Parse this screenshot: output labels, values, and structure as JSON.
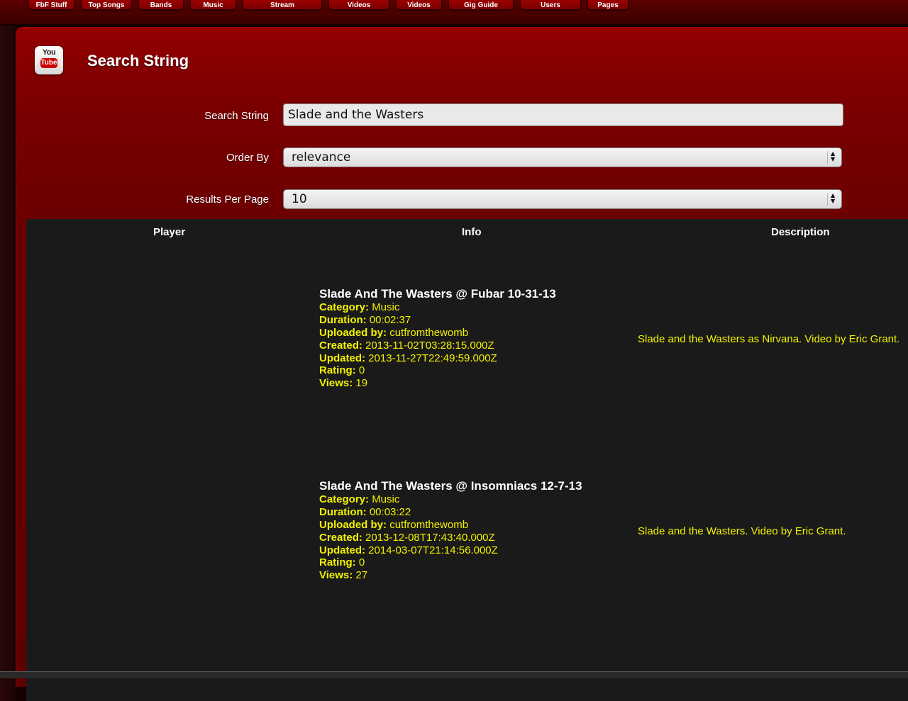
{
  "nav": {
    "items": [
      {
        "label": "FbF Stuff"
      },
      {
        "label": "Top Songs"
      },
      {
        "label": "Bands"
      },
      {
        "label": "Music"
      },
      {
        "label": "Stream"
      },
      {
        "label": "Videos"
      },
      {
        "label": "Videos"
      },
      {
        "label": "Gig Guide"
      },
      {
        "label": "Users"
      },
      {
        "label": "Pages"
      }
    ]
  },
  "panel": {
    "logo_you": "You",
    "logo_tube": "Tube",
    "title": "Search String"
  },
  "form": {
    "search_label": "Search String",
    "search_value": "Slade and the Wasters",
    "order_label": "Order By",
    "order_value": "relevance",
    "results_label": "Results Per Page",
    "results_value": "10"
  },
  "table": {
    "headers": {
      "player": "Player",
      "info": "Info",
      "description": "Description"
    },
    "keys": {
      "category": "Category:",
      "duration": "Duration:",
      "uploaded_by": "Uploaded by:",
      "created": "Created:",
      "updated": "Updated:",
      "rating": "Rating:",
      "views": "Views:"
    },
    "rows": [
      {
        "title": "Slade And The Wasters @ Fubar 10-31-13",
        "category": "Music",
        "duration": "00:02:37",
        "uploaded_by": "cutfromthewomb",
        "created": "2013-11-02T03:28:15.000Z",
        "updated": "2013-11-27T22:49:59.000Z",
        "rating": "0",
        "views": "19",
        "description": "Slade and the Wasters as Nirvana. Video by Eric Grant."
      },
      {
        "title": "Slade And The Wasters @ Insomniacs 12-7-13",
        "category": "Music",
        "duration": "00:03:22",
        "uploaded_by": "cutfromthewomb",
        "created": "2013-12-08T17:43:40.000Z",
        "updated": "2014-03-07T21:14:56.000Z",
        "rating": "0",
        "views": "27",
        "description": "Slade and the Wasters. Video by Eric Grant."
      }
    ]
  }
}
